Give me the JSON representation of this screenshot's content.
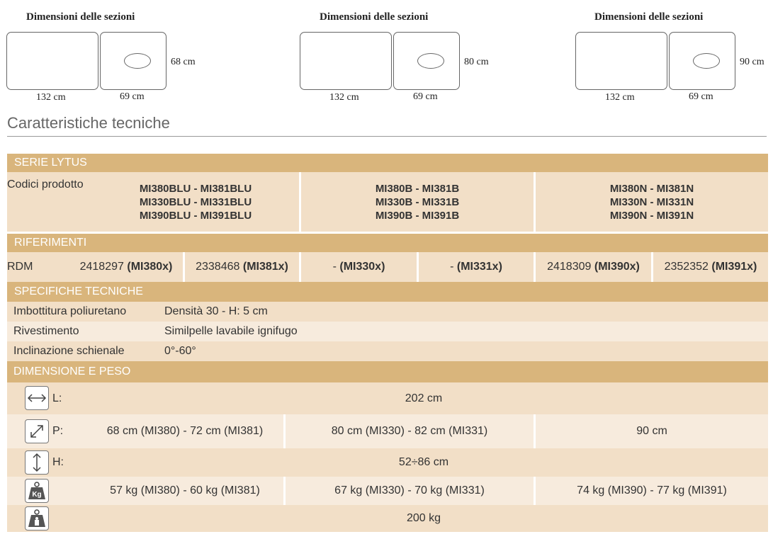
{
  "diagrams": [
    {
      "title": "Dimensioni delle sezioni",
      "length1": "132 cm",
      "length2": "69 cm",
      "width": "68 cm"
    },
    {
      "title": "Dimensioni delle sezioni",
      "length1": "132 cm",
      "length2": "69 cm",
      "width": "80 cm"
    },
    {
      "title": "Dimensioni delle sezioni",
      "length1": "132 cm",
      "length2": "69 cm",
      "width": "90 cm"
    }
  ],
  "section_title": "Caratteristiche tecniche",
  "serie": {
    "header": "SERIE LYTUS",
    "label": "Codici prodotto",
    "groups": [
      [
        "MI380BLU - MI381BLU",
        "MI330BLU - MI331BLU",
        "MI390BLU - MI391BLU"
      ],
      [
        "MI380B - MI381B",
        "MI330B - MI331B",
        "MI390B - MI391B"
      ],
      [
        "MI380N - MI381N",
        "MI330N - MI331N",
        "MI390N - MI391N"
      ]
    ]
  },
  "riferimenti": {
    "header": "RIFERIMENTI",
    "label": "RDM",
    "cells": [
      {
        "num": "2418297",
        "code": "(MI380x)"
      },
      {
        "num": "2338468",
        "code": "(MI381x)"
      },
      {
        "num": "-",
        "code": "(MI330x)"
      },
      {
        "num": "-",
        "code": "(MI331x)"
      },
      {
        "num": "2418309",
        "code": "(MI390x)"
      },
      {
        "num": "2352352",
        "code": "(MI391x)"
      }
    ]
  },
  "specifiche": {
    "header": "SPECIFICHE TECNICHE",
    "rows": [
      {
        "label": "Imbottitura poliuretano",
        "value": "Densità 30 - H: 5 cm"
      },
      {
        "label": "Rivestimento",
        "value": "Similpelle lavabile ignifugo"
      },
      {
        "label": "Inclinazione schienale",
        "value": "0°-60°"
      }
    ]
  },
  "dimensione": {
    "header": "DIMENSIONE E PESO",
    "length": {
      "label": "L:",
      "value": "202 cm"
    },
    "depth": {
      "label": "P:",
      "values": [
        "68 cm (MI380) - 72 cm (MI381)",
        "80 cm (MI330) - 82 cm (MI331)",
        "90 cm"
      ]
    },
    "height": {
      "label": "H:",
      "value": "52÷86 cm"
    },
    "weight": {
      "icon_text": "Kg",
      "values": [
        "57 kg (MI380) - 60 kg (MI381)",
        "67 kg (MI330) - 70 kg (MI331)",
        "74 kg (MI390) - 77 kg (MI391)"
      ]
    },
    "max_load": {
      "value": "200 kg"
    }
  }
}
